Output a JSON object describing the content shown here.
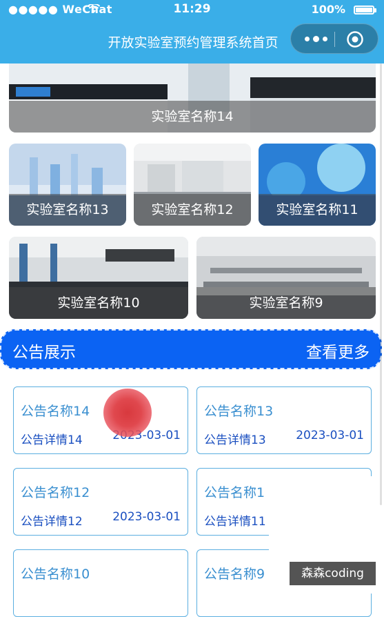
{
  "status_bar": {
    "carrier": "●●●●● WeChat",
    "time": "11:29",
    "battery": "100%"
  },
  "nav": {
    "title": "开放实验室预约管理系统首页"
  },
  "labs": [
    {
      "name": "实验室名称14"
    },
    {
      "name": "实验室名称13"
    },
    {
      "name": "实验室名称12"
    },
    {
      "name": "实验室名称11"
    },
    {
      "name": "实验室名称10"
    },
    {
      "name": "实验室名称9"
    }
  ],
  "notice_section": {
    "title": "公告展示",
    "more": "查看更多"
  },
  "notices": [
    {
      "title": "公告名称14",
      "detail": "公告详情14",
      "date": "2023-03-01"
    },
    {
      "title": "公告名称13",
      "detail": "公告详情13",
      "date": "2023-03-01"
    },
    {
      "title": "公告名称12",
      "detail": "公告详情12",
      "date": "2023-03-01"
    },
    {
      "title": "公告名称1",
      "detail": "公告详情11",
      "date": ""
    },
    {
      "title": "公告名称10",
      "detail": "",
      "date": ""
    },
    {
      "title": "公告名称9",
      "detail": "",
      "date": ""
    }
  ],
  "watermark": "森森coding"
}
